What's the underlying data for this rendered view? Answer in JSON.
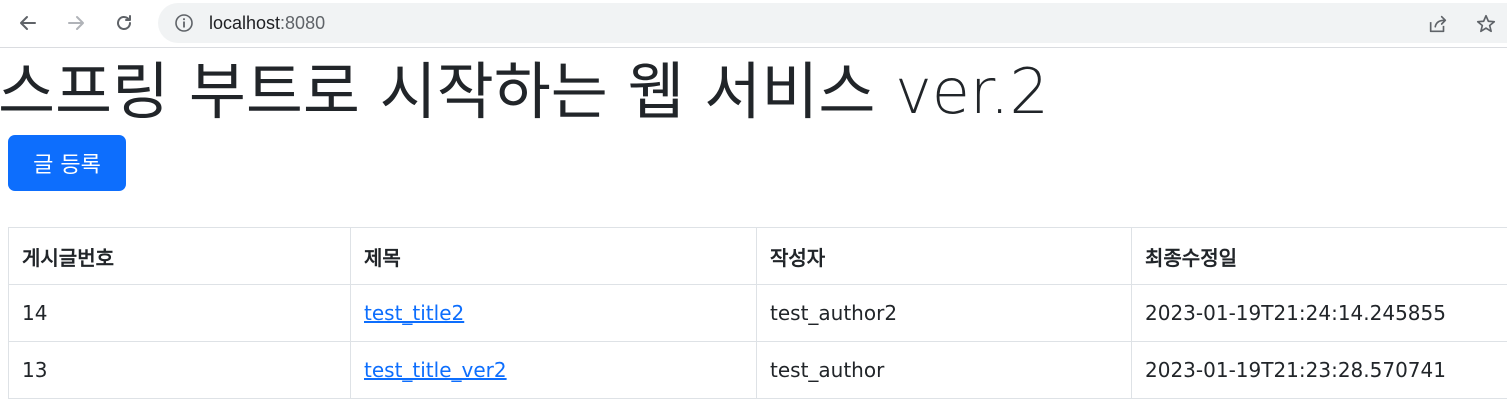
{
  "browser": {
    "back_icon": "arrow-left-icon",
    "forward_icon": "arrow-right-icon",
    "reload_icon": "reload-icon",
    "info_icon": "info-icon",
    "url_host": "localhost",
    "url_port": ":8080",
    "share_icon": "share-icon",
    "bookmark_icon": "star-icon"
  },
  "page": {
    "title": "스프링 부트로 시작하는 웹 서비스 ver.2",
    "register_button": "글 등록"
  },
  "table": {
    "headers": [
      "게시글번호",
      "제목",
      "작성자",
      "최종수정일"
    ],
    "rows": [
      {
        "id": "14",
        "title": "test_title2",
        "author": "test_author2",
        "modified": "2023-01-19T21:24:14.245855"
      },
      {
        "id": "13",
        "title": "test_title_ver2",
        "author": "test_author",
        "modified": "2023-01-19T21:23:28.570741"
      }
    ]
  },
  "colors": {
    "primary": "#0d6efd",
    "border": "#dee2e6",
    "omnibox_bg": "#f1f3f4"
  }
}
